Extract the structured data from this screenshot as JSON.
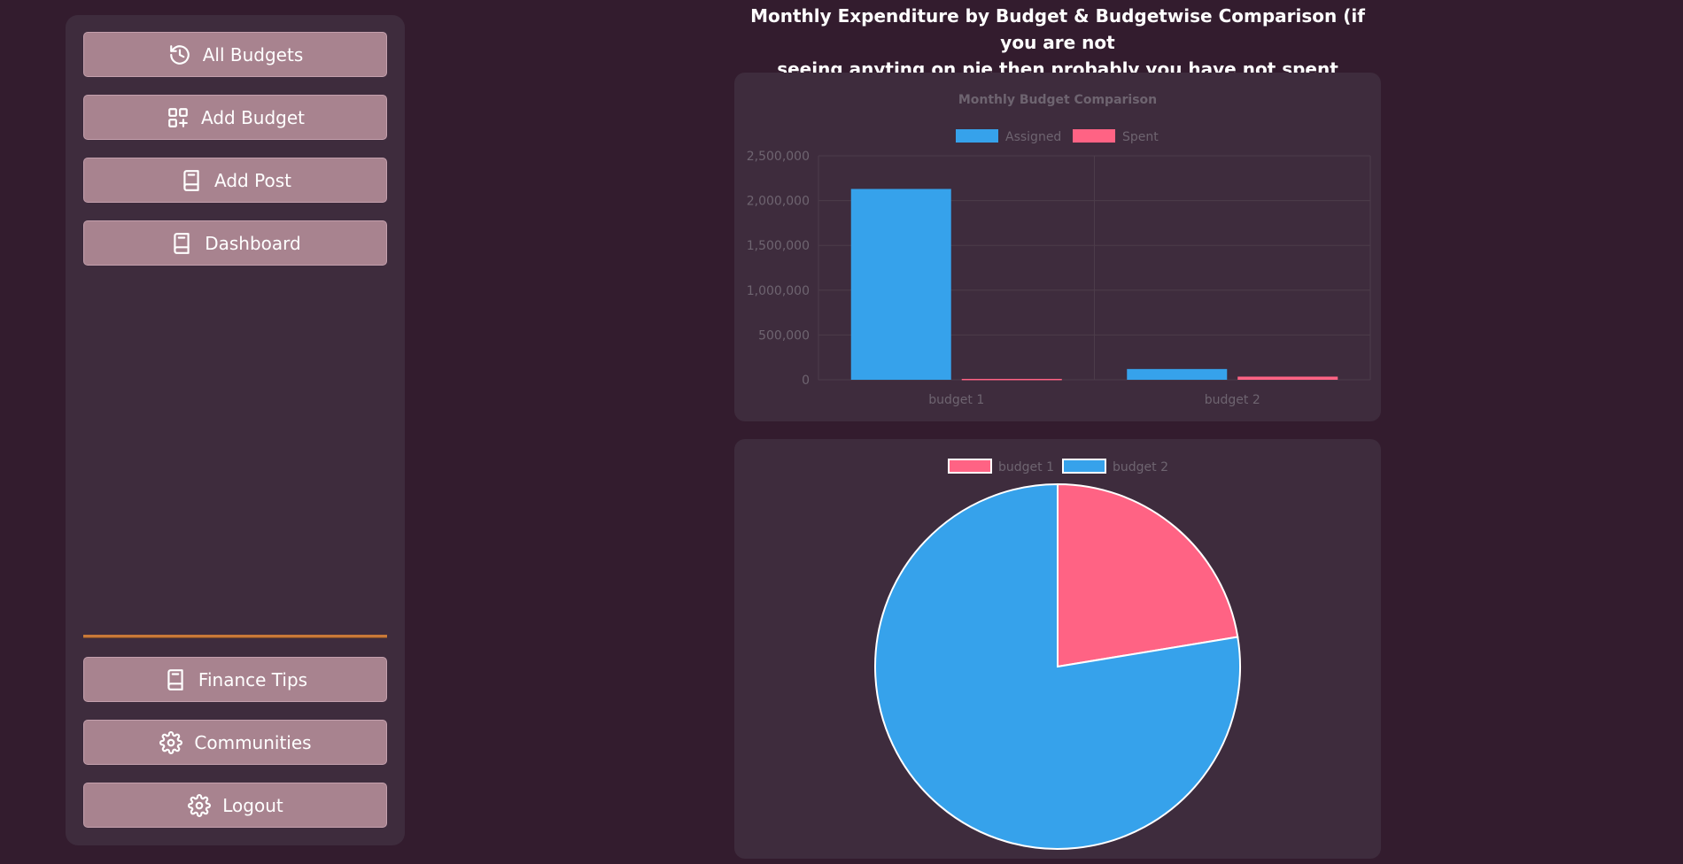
{
  "sidebar": {
    "top_items": [
      {
        "label": "All Budgets",
        "icon": "history-icon"
      },
      {
        "label": "Add Budget",
        "icon": "add-grid-icon"
      },
      {
        "label": "Add Post",
        "icon": "book-icon"
      },
      {
        "label": "Dashboard",
        "icon": "book-icon"
      }
    ],
    "bottom_items": [
      {
        "label": "Finance Tips",
        "icon": "book-icon"
      },
      {
        "label": "Communities",
        "icon": "gear-icon"
      },
      {
        "label": "Logout",
        "icon": "gear-icon"
      }
    ]
  },
  "main": {
    "heading_line1": "Monthly Expenditure by Budget & Budgetwise Comparison (if you are not",
    "heading_line2": "seeing anyting on pie then probably you have not spent monthly or reset )"
  },
  "colors": {
    "background": "#331c2e",
    "panel": "#3e2c3d",
    "button": "#a8838f",
    "divider": "#c87838",
    "assigned": "#36a2eb",
    "spent": "#ff6384"
  },
  "chart_data": [
    {
      "type": "bar",
      "title": "Monthly Budget Comparison",
      "categories": [
        "budget 1",
        "budget 2"
      ],
      "series": [
        {
          "name": "Assigned",
          "values": [
            2130000,
            120000
          ],
          "color": "#36a2eb"
        },
        {
          "name": "Spent",
          "values": [
            10000,
            35000
          ],
          "color": "#ff6384"
        }
      ],
      "ylim": [
        0,
        2500000
      ],
      "yticks": [
        "0",
        "500,000",
        "1,000,000",
        "1,500,000",
        "2,000,000",
        "2,500,000"
      ],
      "ytick_values": [
        0,
        500000,
        1000000,
        1500000,
        2000000,
        2500000
      ],
      "legend": "top",
      "grid": true
    },
    {
      "type": "pie",
      "labels": [
        "budget 1",
        "budget 2"
      ],
      "values": [
        22.4,
        77.6
      ],
      "colors": [
        "#ff6384",
        "#36a2eb"
      ],
      "legend": "top"
    }
  ]
}
